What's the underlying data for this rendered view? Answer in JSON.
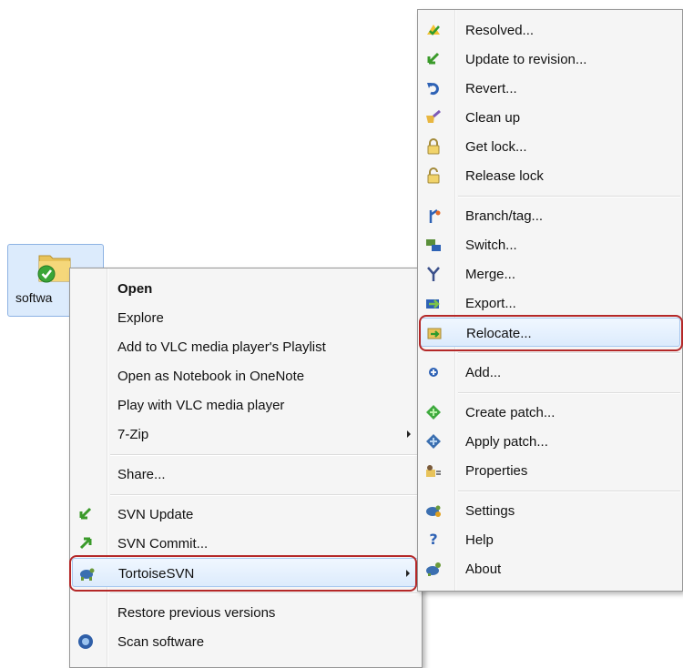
{
  "desktop": {
    "file_label": "softwa"
  },
  "context_menu": {
    "items": [
      {
        "label": "Open",
        "bold": true
      },
      {
        "label": "Explore"
      },
      {
        "label": "Add to VLC media player's Playlist"
      },
      {
        "label": "Open as Notebook in OneNote"
      },
      {
        "label": "Play with VLC media player"
      },
      {
        "label": "7-Zip",
        "submenu": true
      },
      {
        "label": "Share..."
      },
      {
        "label": "SVN Update",
        "icon": "svn-update-icon"
      },
      {
        "label": "SVN Commit...",
        "icon": "svn-commit-icon"
      },
      {
        "label": "TortoiseSVN",
        "icon": "tortoisesvn-icon",
        "submenu": true,
        "highlighted": true
      },
      {
        "label": "Restore previous versions"
      },
      {
        "label": "Scan software",
        "icon": "scan-icon"
      }
    ]
  },
  "tortoise_submenu": {
    "items": [
      {
        "label": "Resolved...",
        "icon": "resolved-icon"
      },
      {
        "label": "Update to revision...",
        "icon": "update-revision-icon"
      },
      {
        "label": "Revert...",
        "icon": "revert-icon"
      },
      {
        "label": "Clean up",
        "icon": "cleanup-icon"
      },
      {
        "label": "Get lock...",
        "icon": "lock-icon"
      },
      {
        "label": "Release lock",
        "icon": "unlock-icon"
      },
      {
        "label": "Branch/tag...",
        "icon": "branch-icon"
      },
      {
        "label": "Switch...",
        "icon": "switch-icon"
      },
      {
        "label": "Merge...",
        "icon": "merge-icon"
      },
      {
        "label": "Export...",
        "icon": "export-icon"
      },
      {
        "label": "Relocate...",
        "icon": "relocate-icon",
        "highlighted": true
      },
      {
        "label": "Add...",
        "icon": "add-icon"
      },
      {
        "label": "Create patch...",
        "icon": "create-patch-icon"
      },
      {
        "label": "Apply patch...",
        "icon": "apply-patch-icon"
      },
      {
        "label": "Properties",
        "icon": "properties-icon"
      },
      {
        "label": "Settings",
        "icon": "settings-icon"
      },
      {
        "label": "Help",
        "icon": "help-icon"
      },
      {
        "label": "About",
        "icon": "about-icon"
      }
    ]
  },
  "colors": {
    "callout": "#b42828",
    "highlight": "#dcebfc",
    "menu_bg": "#f5f5f5"
  }
}
